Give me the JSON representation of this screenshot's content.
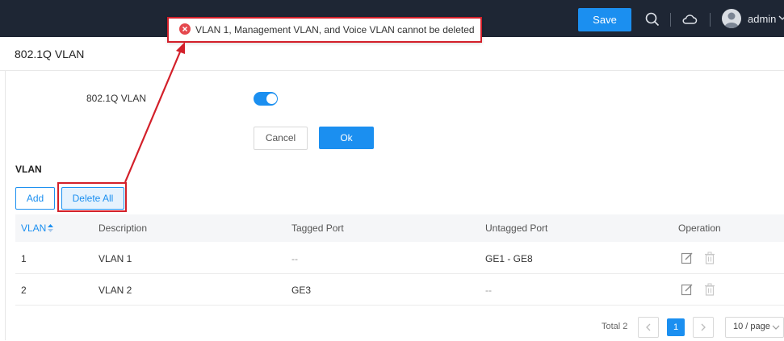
{
  "topbar": {
    "save_label": "Save",
    "user_name": "admin"
  },
  "page": {
    "title": "802.1Q VLAN"
  },
  "form": {
    "label": "802.1Q VLAN",
    "enabled": true,
    "cancel_label": "Cancel",
    "ok_label": "Ok"
  },
  "vlan_section": {
    "title": "VLAN",
    "add_label": "Add",
    "delete_all_label": "Delete All"
  },
  "table": {
    "columns": [
      "VLAN",
      "Description",
      "Tagged Port",
      "Untagged Port",
      "Operation"
    ],
    "rows": [
      {
        "vlan": "1",
        "description": "VLAN 1",
        "tagged": "--",
        "untagged": "GE1 - GE8"
      },
      {
        "vlan": "2",
        "description": "VLAN 2",
        "tagged": "GE3",
        "untagged": "--"
      }
    ]
  },
  "pagination": {
    "total_label": "Total 2",
    "current_page": "1",
    "page_size_label": "10 / page"
  },
  "error": {
    "message": "VLAN 1, Management VLAN, and Voice VLAN cannot be deleted"
  },
  "colors": {
    "accent": "#1b8ff0",
    "topbar": "#1e2634",
    "highlight": "#d3202a"
  }
}
